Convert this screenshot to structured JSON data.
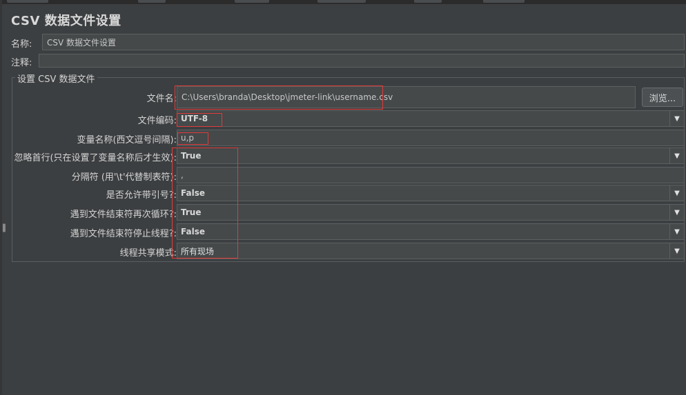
{
  "title": "CSV 数据文件设置",
  "name": {
    "label": "名称:",
    "value": "CSV 数据文件设置"
  },
  "comment": {
    "label": "注释:",
    "value": ""
  },
  "group": {
    "title": "设置 CSV 数据文件",
    "filename": {
      "label": "文件名:",
      "value": "C:\\Users\\branda\\Desktop\\jmeter-link\\username.csv",
      "browse_label": "浏览..."
    },
    "encoding": {
      "label": "文件编码:",
      "value": "UTF-8"
    },
    "variables": {
      "label": "变量名称(西文逗号间隔):",
      "value": "u,p"
    },
    "ignore_first": {
      "label": "忽略首行(只在设置了变量名称后才生效):",
      "value": "True"
    },
    "delimiter": {
      "label": "分隔符 (用'\\t'代替制表符):",
      "value": ","
    },
    "quoted": {
      "label": "是否允许带引号?:",
      "value": "False"
    },
    "recycle": {
      "label": "遇到文件结束符再次循环?:",
      "value": "True"
    },
    "stop_thread": {
      "label": "遇到文件结束符停止线程?:",
      "value": "False"
    },
    "sharing": {
      "label": "线程共享模式:",
      "value": "所有现场"
    }
  },
  "dropdown_icon": "triangle-down-icon",
  "accent_color": "#e23b3b"
}
